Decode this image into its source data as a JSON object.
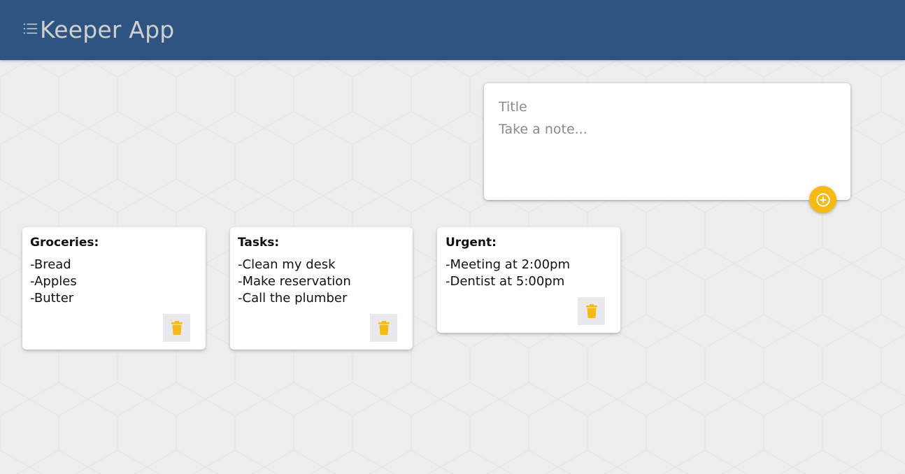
{
  "header": {
    "title": "Keeper App",
    "icon": "list-icon"
  },
  "create_note": {
    "title_placeholder": "Title",
    "content_placeholder": "Take a note...",
    "add_icon": "add-circle-icon"
  },
  "notes": [
    {
      "title": "Groceries:",
      "lines": [
        "-Bread",
        "-Apples",
        "-Butter"
      ]
    },
    {
      "title": "Tasks:",
      "lines": [
        "-Clean my desk",
        "-Make reservation",
        "-Call the plumber"
      ]
    },
    {
      "title": "Urgent:",
      "lines": [
        "-Meeting at 2:00pm",
        "-Dentist at 5:00pm"
      ]
    }
  ],
  "colors": {
    "header_bg": "#2e5582",
    "header_text": "#d0d0d0",
    "accent": "#f5ba13",
    "page_bg": "#ededed"
  }
}
